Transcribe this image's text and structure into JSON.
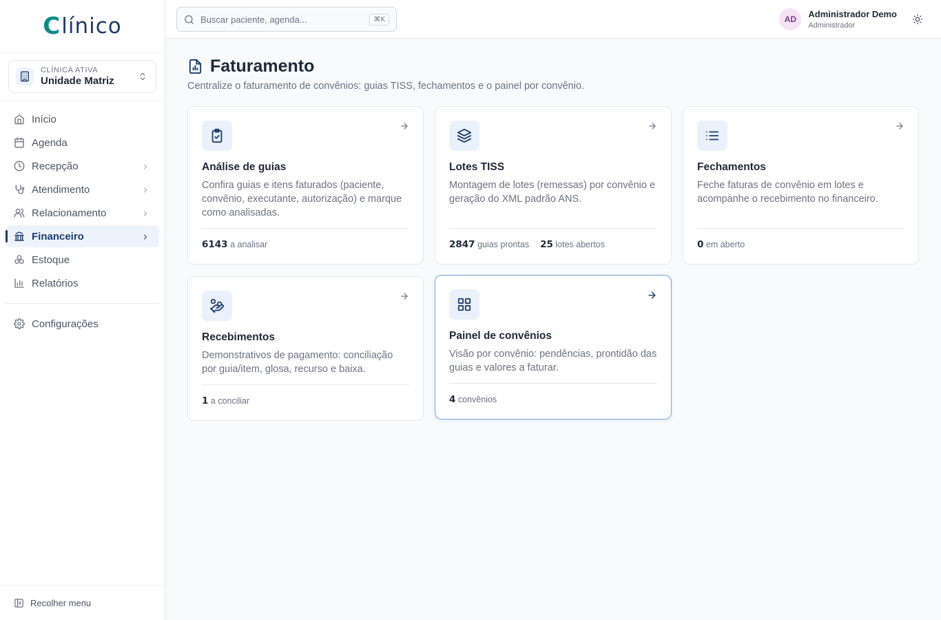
{
  "brand": {
    "logo_c": "C",
    "logo_rest": "línico"
  },
  "clinic": {
    "label": "CLÍNICA ATIVA",
    "name": "Unidade Matriz"
  },
  "nav": {
    "items": [
      {
        "label": "Início",
        "icon": "home-icon"
      },
      {
        "label": "Agenda",
        "icon": "calendar-icon"
      },
      {
        "label": "Recepção",
        "icon": "clock-icon"
      },
      {
        "label": "Atendimento",
        "icon": "stethoscope-icon"
      },
      {
        "label": "Relacionamento",
        "icon": "users-icon"
      },
      {
        "label": "Financeiro",
        "icon": "bank-icon"
      },
      {
        "label": "Estoque",
        "icon": "boxes-icon"
      },
      {
        "label": "Relatórios",
        "icon": "bar-chart-icon"
      }
    ],
    "settings": "Configurações",
    "collapse": "Recolher menu"
  },
  "topbar": {
    "search_placeholder": "Buscar paciente, agenda...",
    "shortcut": "⌘K",
    "user_initials": "AD",
    "user_name": "Administrador Demo",
    "user_role": "Administrador"
  },
  "page": {
    "title": "Faturamento",
    "subtitle": "Centralize o faturamento de convênios: guias TISS, fechamentos e o painel por convênio."
  },
  "cards": [
    {
      "title": "Análise de guias",
      "desc": "Confira guias e itens faturados (paciente, convênio, executante, autorização) e marque como analisadas.",
      "stats": [
        {
          "value": "6143",
          "label": "a analisar"
        }
      ],
      "icon": "clipboard-check-icon"
    },
    {
      "title": "Lotes TISS",
      "desc": "Montagem de lotes (remessas) por convênio e geração do XML padrão ANS.",
      "stats": [
        {
          "value": "2847",
          "label": "guias prontas"
        },
        {
          "value": "25",
          "label": "lotes abertos"
        }
      ],
      "icon": "layers-icon"
    },
    {
      "title": "Fechamentos",
      "desc": "Feche faturas de convênio em lotes e acompanhe o recebimento no financeiro.",
      "stats": [
        {
          "value": "0",
          "label": "em aberto"
        }
      ],
      "icon": "list-icon"
    },
    {
      "title": "Recebimentos",
      "desc": "Demonstrativos de pagamento: conciliação por guia/item, glosa, recurso e baixa.",
      "stats": [
        {
          "value": "1",
          "label": "a conciliar"
        }
      ],
      "icon": "hand-coins-icon"
    },
    {
      "title": "Painel de convênios",
      "desc": "Visão por convênio: pendências, prontidão das guias e valores a faturar.",
      "stats": [
        {
          "value": "4",
          "label": "convênios"
        }
      ],
      "icon": "grid-icon"
    }
  ],
  "colors": {
    "primary": "#1e3a6b",
    "accent": "#0e8a86",
    "icon_bg": "#eaf1fb"
  }
}
